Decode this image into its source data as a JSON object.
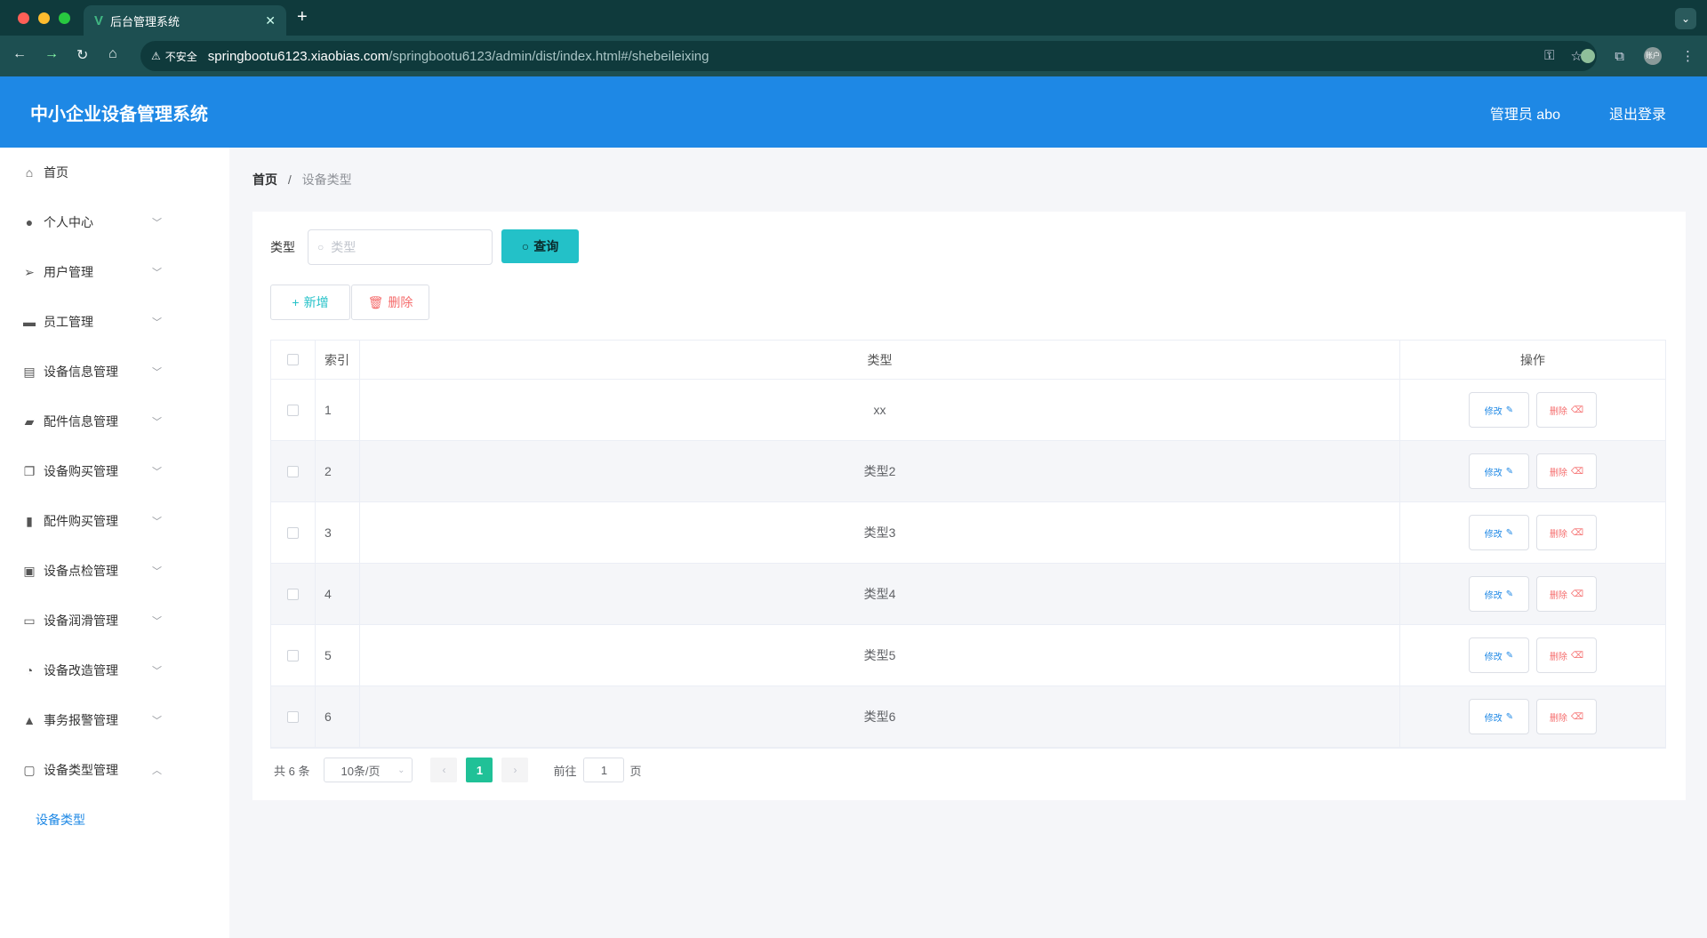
{
  "browser": {
    "tab_title": "后台管理系统",
    "new_tab": "+",
    "security_label": "不安全",
    "url_host": "springbootu6123.xiaobias.com",
    "url_path": "/springbootu6123/admin/dist/index.html#/shebeileixing",
    "profile": "账户"
  },
  "header": {
    "title": "中小企业设备管理系统",
    "user": "管理员 abo",
    "logout": "退出登录"
  },
  "sidebar": {
    "items": [
      {
        "label": "首页",
        "icon": "home-icon",
        "glyph": "⌂"
      },
      {
        "label": "个人中心",
        "icon": "user-icon",
        "glyph": "●"
      },
      {
        "label": "用户管理",
        "icon": "send-icon",
        "glyph": "➢"
      },
      {
        "label": "员工管理",
        "icon": "monitor-icon",
        "glyph": "▬"
      },
      {
        "label": "设备信息管理",
        "icon": "clipboard-icon",
        "glyph": "▤"
      },
      {
        "label": "配件信息管理",
        "icon": "coffee-icon",
        "glyph": "▰"
      },
      {
        "label": "设备购买管理",
        "icon": "copy-icon",
        "glyph": "❐"
      },
      {
        "label": "配件购买管理",
        "icon": "bar-chart-icon",
        "glyph": "▮"
      },
      {
        "label": "设备点检管理",
        "icon": "check-list-icon",
        "glyph": "▣"
      },
      {
        "label": "设备润滑管理",
        "icon": "chat-icon",
        "glyph": "▭"
      },
      {
        "label": "设备改造管理",
        "icon": "compass-icon",
        "glyph": "◔"
      },
      {
        "label": "事务报警管理",
        "icon": "person-icon",
        "glyph": "▲"
      },
      {
        "label": "设备类型管理",
        "icon": "postcard-icon",
        "glyph": "▢"
      }
    ],
    "sub_item": "设备类型"
  },
  "breadcrumb": {
    "home": "首页",
    "sep": "/",
    "current": "设备类型"
  },
  "search": {
    "label": "类型",
    "placeholder": "类型",
    "button": "查询"
  },
  "actions": {
    "add": "新增",
    "delete": "删除"
  },
  "table": {
    "headers": {
      "index": "索引",
      "type": "类型",
      "ops": "操作"
    },
    "edit_label": "修改",
    "delete_label": "删除",
    "rows": [
      {
        "index": "1",
        "type": "xx"
      },
      {
        "index": "2",
        "type": "类型2"
      },
      {
        "index": "3",
        "type": "类型3"
      },
      {
        "index": "4",
        "type": "类型4"
      },
      {
        "index": "5",
        "type": "类型5"
      },
      {
        "index": "6",
        "type": "类型6"
      }
    ]
  },
  "pagination": {
    "total": "共 6 条",
    "page_size": "10条/页",
    "current": "1",
    "goto": "前往",
    "goto_value": "1",
    "page_suffix": "页"
  },
  "colors": {
    "header_bg": "#1e88e5",
    "accent_teal": "#23c1c8",
    "page_active": "#20c197",
    "danger": "#f56c6c"
  }
}
